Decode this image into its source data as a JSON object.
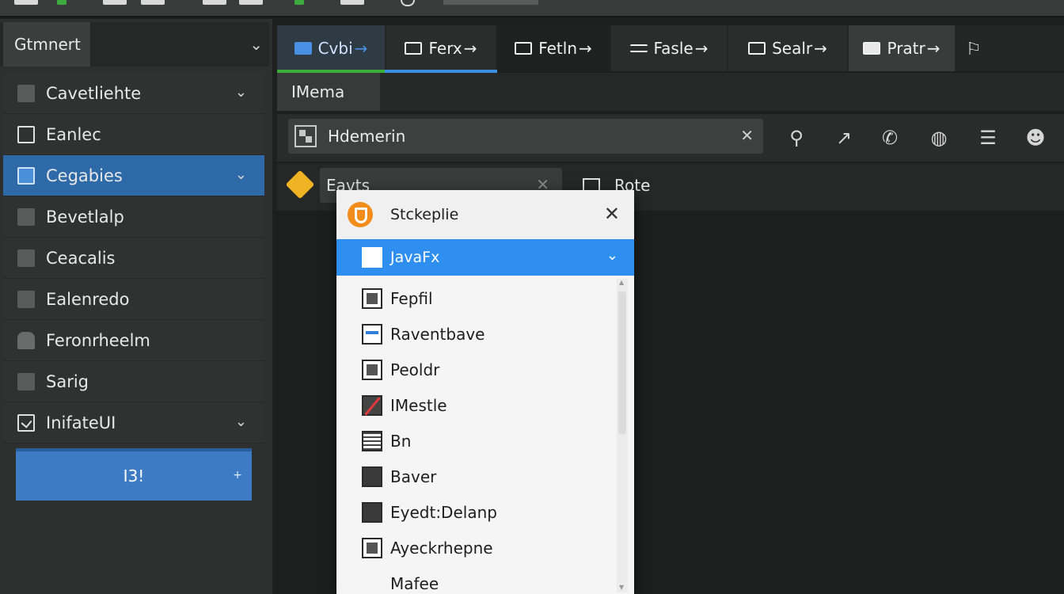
{
  "sidebar": {
    "header": "Gtmnert",
    "items": [
      {
        "label": "Cavetliehte",
        "icon": "folder-icon",
        "chevron": true
      },
      {
        "label": "Eanlec",
        "icon": "checkbox-icon",
        "chevron": false
      },
      {
        "label": "Cegabies",
        "icon": "window-icon",
        "chevron": true,
        "active": true
      },
      {
        "label": "Bevetlalp",
        "icon": "panel-icon",
        "chevron": false
      },
      {
        "label": "Ceacalis",
        "icon": "grid-icon",
        "chevron": false
      },
      {
        "label": "Ealenredo",
        "icon": "file-icon",
        "chevron": false
      },
      {
        "label": "Feronrheelm",
        "icon": "flag-icon",
        "chevron": false
      },
      {
        "label": "Sarig",
        "icon": "doc-icon",
        "chevron": false
      },
      {
        "label": "InifateUI",
        "icon": "check-icon",
        "chevron": true
      }
    ],
    "button_label": "I3!",
    "button_plus": "+"
  },
  "tabs": [
    {
      "label": "Cvbi",
      "icon": "layout-icon"
    },
    {
      "label": "Ferx",
      "icon": "image-icon"
    },
    {
      "label": "Fetln",
      "icon": "frame-icon"
    },
    {
      "label": "Fasle",
      "icon": "list-icon"
    },
    {
      "label": "Sealr",
      "icon": "box-icon"
    },
    {
      "label": "Pratr",
      "icon": "card-icon"
    }
  ],
  "tab_arrow": "→",
  "subtab": "IMema",
  "search": {
    "value": "Hdemerin",
    "clear": "✕"
  },
  "filter": {
    "value": "Eavts",
    "clear": "✕"
  },
  "route_label": "Rote",
  "toolbar_icons": [
    "search-icon",
    "arrow-icon",
    "phone-icon",
    "globe-icon",
    "menu-icon",
    "face-icon"
  ],
  "dropdown": {
    "title": "Stckeplie",
    "close": "✕",
    "selected": "JavaFx",
    "items": [
      {
        "label": "Fepfil",
        "icon": "i-inner"
      },
      {
        "label": "Raventbave",
        "icon": "i-blue"
      },
      {
        "label": "Peoldr",
        "icon": "i-inner"
      },
      {
        "label": "IMestle",
        "icon": "i-red"
      },
      {
        "label": "Bn",
        "icon": "i-lines"
      },
      {
        "label": "Baver",
        "icon": "i-dark"
      },
      {
        "label": "Eyedt:Delanp",
        "icon": "i-dark"
      },
      {
        "label": "Ayeckrhepne",
        "icon": "i-inner"
      },
      {
        "label": "Mafee",
        "icon": "i-none"
      }
    ]
  },
  "colors": {
    "accent_blue": "#2f8ff0",
    "sidebar_active": "#2e6aa8",
    "tab_green": "#3cae3c",
    "logo_orange": "#f28c1a",
    "diamond_yellow": "#f0b323"
  }
}
